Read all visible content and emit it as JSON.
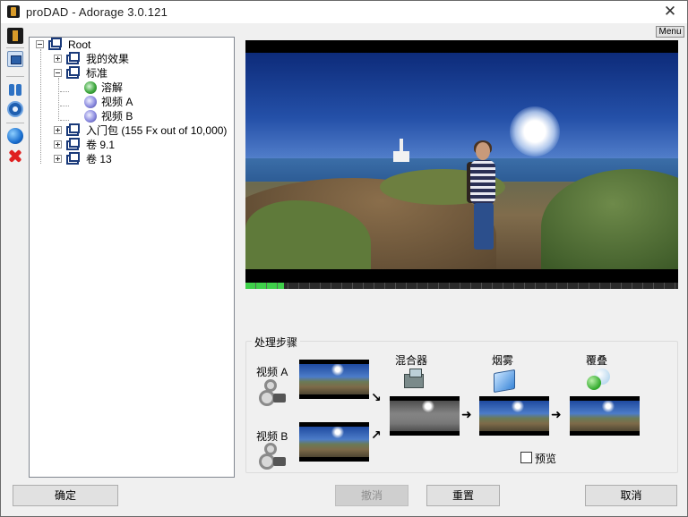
{
  "window": {
    "title": "proDAD - Adorage 3.0.121"
  },
  "toolbar": {
    "icons": [
      "logo-icon",
      "screen-icon",
      "binoculars-icon",
      "gear-icon",
      "sphere-icon",
      "delete-icon"
    ]
  },
  "menu_button": {
    "label": "Menu"
  },
  "tree": {
    "root": "Root",
    "my_effects": "我的效果",
    "standard": "标准",
    "dissolve": "溶解",
    "video_a": "视频 A",
    "video_b": "视频 B",
    "starter_pack": "入门包 (155 Fx out of 10,000)",
    "volume_91": "卷 9.1",
    "volume_13": "卷 13"
  },
  "preview": {
    "progress_percent": 9
  },
  "pipeline": {
    "title": "处理步骤",
    "video_a_label": "视频 A",
    "video_b_label": "视频 B",
    "mixer_label": "混合器",
    "fog_label": "烟雾",
    "overlay_label": "覆叠",
    "preview_checkbox_label": "预览"
  },
  "buttons": {
    "ok": "确定",
    "undo": "撤消",
    "reset": "重置",
    "cancel": "取消"
  },
  "colors": {
    "progress": "#3fd04a",
    "accent": "#1a3a7a"
  }
}
